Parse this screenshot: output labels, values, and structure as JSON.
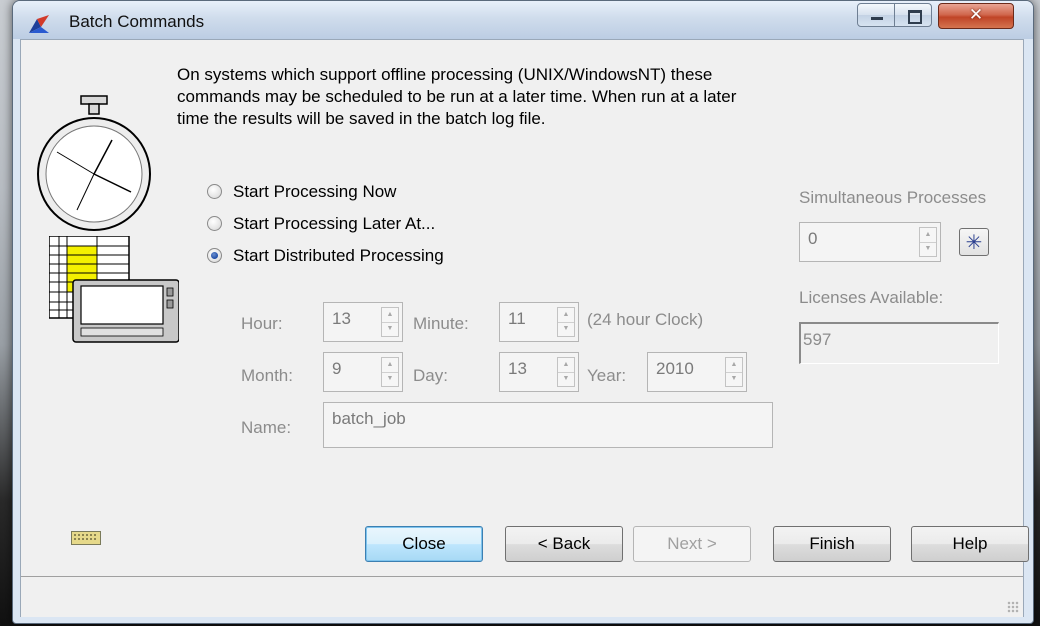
{
  "window": {
    "title": "Batch Commands"
  },
  "intro_text": "On systems which support offline processing (UNIX/WindowsNT) these\ncommands may be scheduled to be run at a later time. When run at a later\ntime the results will be saved in the batch log file.",
  "processing_options": [
    {
      "label": "Start Processing Now",
      "checked": false
    },
    {
      "label": "Start Processing Later At...",
      "checked": false
    },
    {
      "label": "Start Distributed Processing",
      "checked": true
    }
  ],
  "schedule": {
    "hour_label": "Hour:",
    "hour_value": "13",
    "minute_label": "Minute:",
    "minute_value": "11",
    "clock_note": "(24 hour Clock)",
    "month_label": "Month:",
    "month_value": "9",
    "day_label": "Day:",
    "day_value": "13",
    "year_label": "Year:",
    "year_value": "2010",
    "name_label": "Name:",
    "name_value": "batch_job"
  },
  "distributed": {
    "simultaneous_label": "Simultaneous Processes",
    "simultaneous_value": "0",
    "licenses_label": "Licenses Available:",
    "licenses_value": "597"
  },
  "buttons": {
    "close": "Close",
    "back": "< Back",
    "next": "Next >",
    "finish": "Finish",
    "help": "Help"
  },
  "colors": {
    "titlebar": "#cfdcec",
    "close_button": "#c04427",
    "client_bg": "#f0f0f0",
    "disabled_text": "#8c8c8c"
  }
}
